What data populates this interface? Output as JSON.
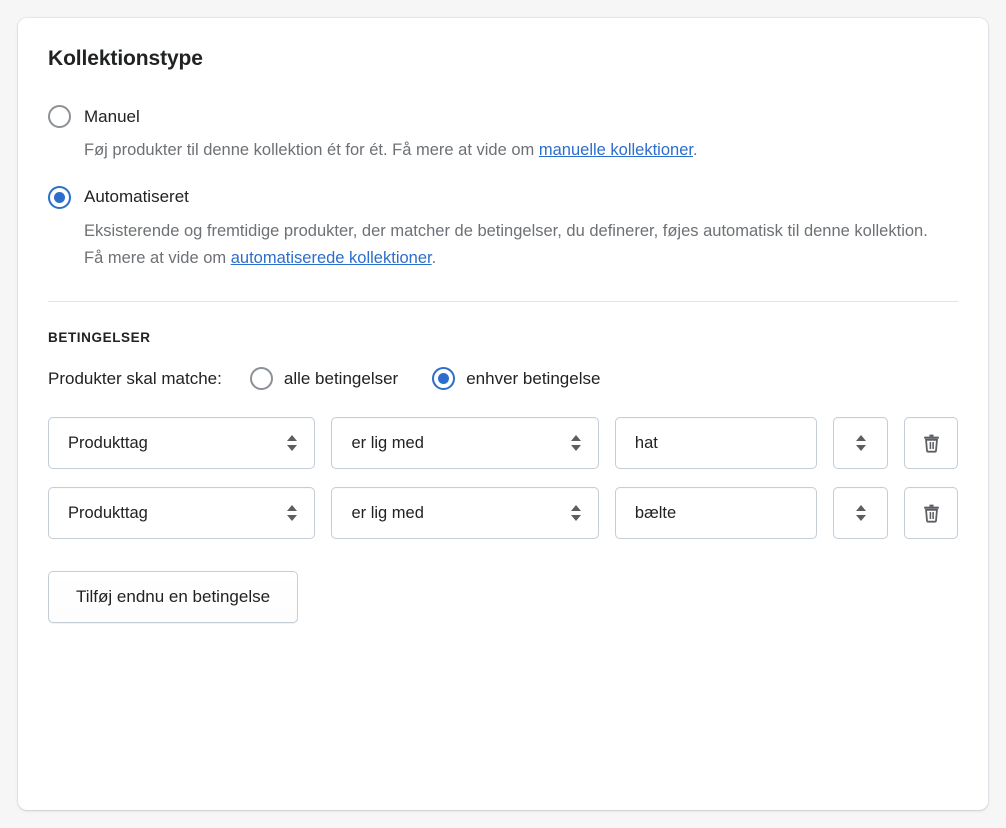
{
  "colors": {
    "page_background": "#f6f6f7",
    "card_background": "#ffffff",
    "accent": "#2c6ecb",
    "text": "#202223",
    "subdued_text": "#6d7175",
    "border": "#c4cdd5",
    "divider": "#e1e3e5"
  },
  "collection_type": {
    "title": "Kollektionstype",
    "options": [
      {
        "label": "Manuel",
        "selected": false,
        "description_before_link": "Føj produkter til denne kollektion ét for ét. Få mere at vide om ",
        "link_text": "manuelle kollektioner",
        "description_after_link": "."
      },
      {
        "label": "Automatiseret",
        "selected": true,
        "description_before_link": "Eksisterende og fremtidige produkter, der matcher de betingelser, du definerer, føjes automatisk til denne kollektion. Få mere at vide om ",
        "link_text": "automatiserede kollektioner",
        "description_after_link": "."
      }
    ]
  },
  "conditions": {
    "heading": "BETINGELSER",
    "match_label": "Produkter skal matche:",
    "match_options": [
      {
        "label": "alle betingelser",
        "selected": false
      },
      {
        "label": "enhver betingelse",
        "selected": true
      }
    ],
    "rows": [
      {
        "subject": "Produkttag",
        "operator": "er lig med",
        "value": "hat"
      },
      {
        "subject": "Produkttag",
        "operator": "er lig med",
        "value": "bælte"
      }
    ],
    "add_button_label": "Tilføj endnu en betingelse"
  }
}
